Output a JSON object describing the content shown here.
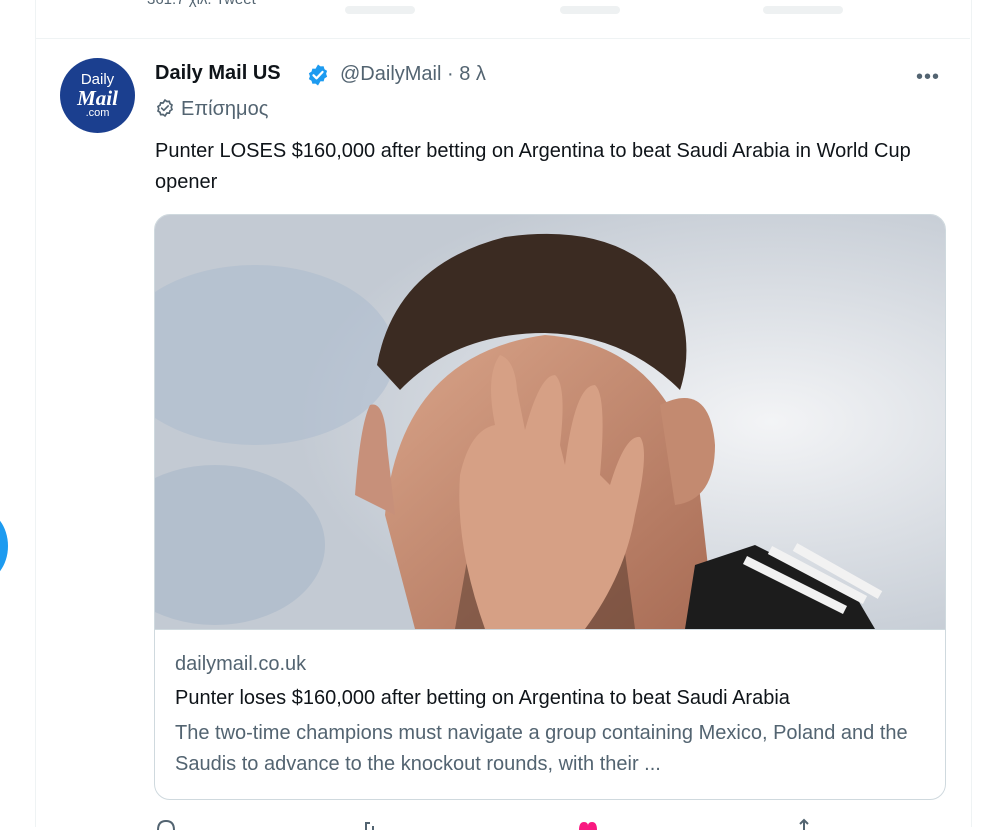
{
  "previous_tweet": {
    "text": "361.7 χιλ. Tweet"
  },
  "tweet": {
    "author_name": "Daily Mail US",
    "handle_time": "@DailyMail · 8 λ",
    "official_label": "Επίσημος",
    "text": "Punter LOSES $160,000 after betting on Argentina to beat Saudi Arabia in World Cup opener",
    "more_icon": "more-icon",
    "avatar": {
      "line1": "Daily",
      "line2": "Mail",
      "line3": ".com"
    }
  },
  "card": {
    "domain": "dailymail.co.uk",
    "title": "Punter loses $160,000 after betting on Argentina to beat Saudi Arabia",
    "description": "The two-time champions must navigate a group containing Mexico, Poland and the Saudis to advance to the knockout rounds, with their ..."
  },
  "colors": {
    "brand_blue": "#1d9bf0",
    "muted": "#536471",
    "text": "#0f1419",
    "heart": "#f91880"
  }
}
